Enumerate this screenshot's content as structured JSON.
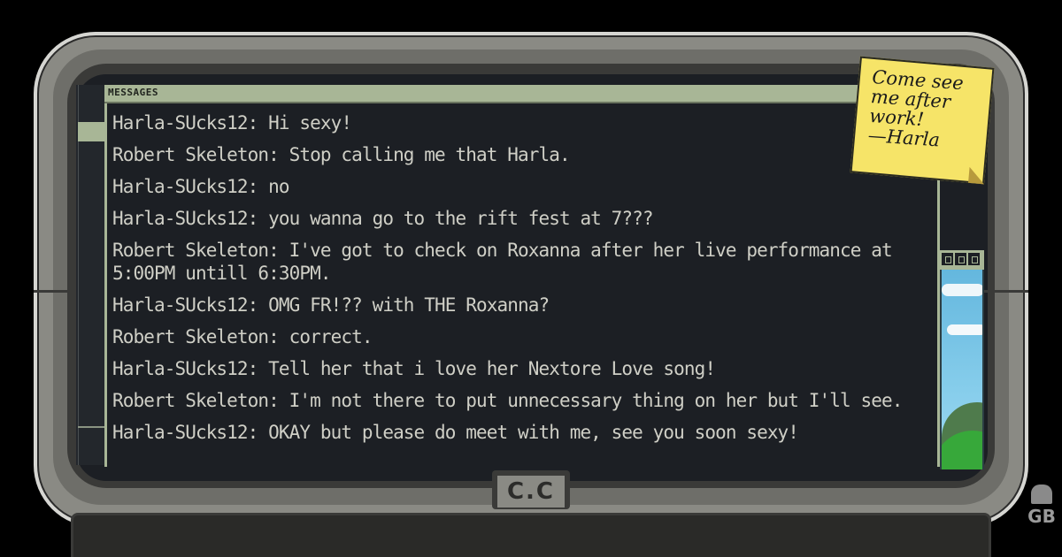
{
  "window": {
    "title": "MESSAGES"
  },
  "messages": [
    {
      "text": "Harla-SUcks12: Hi sexy!"
    },
    {
      "text": "Robert Skeleton: Stop calling me that Harla."
    },
    {
      "text": "Harla-SUcks12: no"
    },
    {
      "text": "Harla-SUcks12: you wanna go to the rift fest at 7???"
    },
    {
      "text": "Robert Skeleton: I've got to check on Roxanna after her live performance at 5:00PM untill 6:30PM."
    },
    {
      "text": "Harla-SUcks12: OMG FR!?? with THE Roxanna?"
    },
    {
      "text": "Robert Skeleton: correct."
    },
    {
      "text": "Harla-SUcks12: Tell her that i love her Nextore Love song!"
    },
    {
      "text": "Robert Skeleton: I'm not there to put unnecessary thing on her but I'll see."
    },
    {
      "text": "Harla-SUcks12: OKAY but please do meet with me, see you soon sexy!"
    }
  ],
  "sticky_note": {
    "line1": "Come see",
    "line2": "me after",
    "line3": "work!",
    "line4": "—Harla"
  },
  "monitor": {
    "label": "C.C"
  },
  "watermark": {
    "text": "GB"
  },
  "colors": {
    "accent": "#a8b696",
    "screen": "#1c1f24",
    "text": "#cfcfc6",
    "sticky": "#f6e468"
  }
}
